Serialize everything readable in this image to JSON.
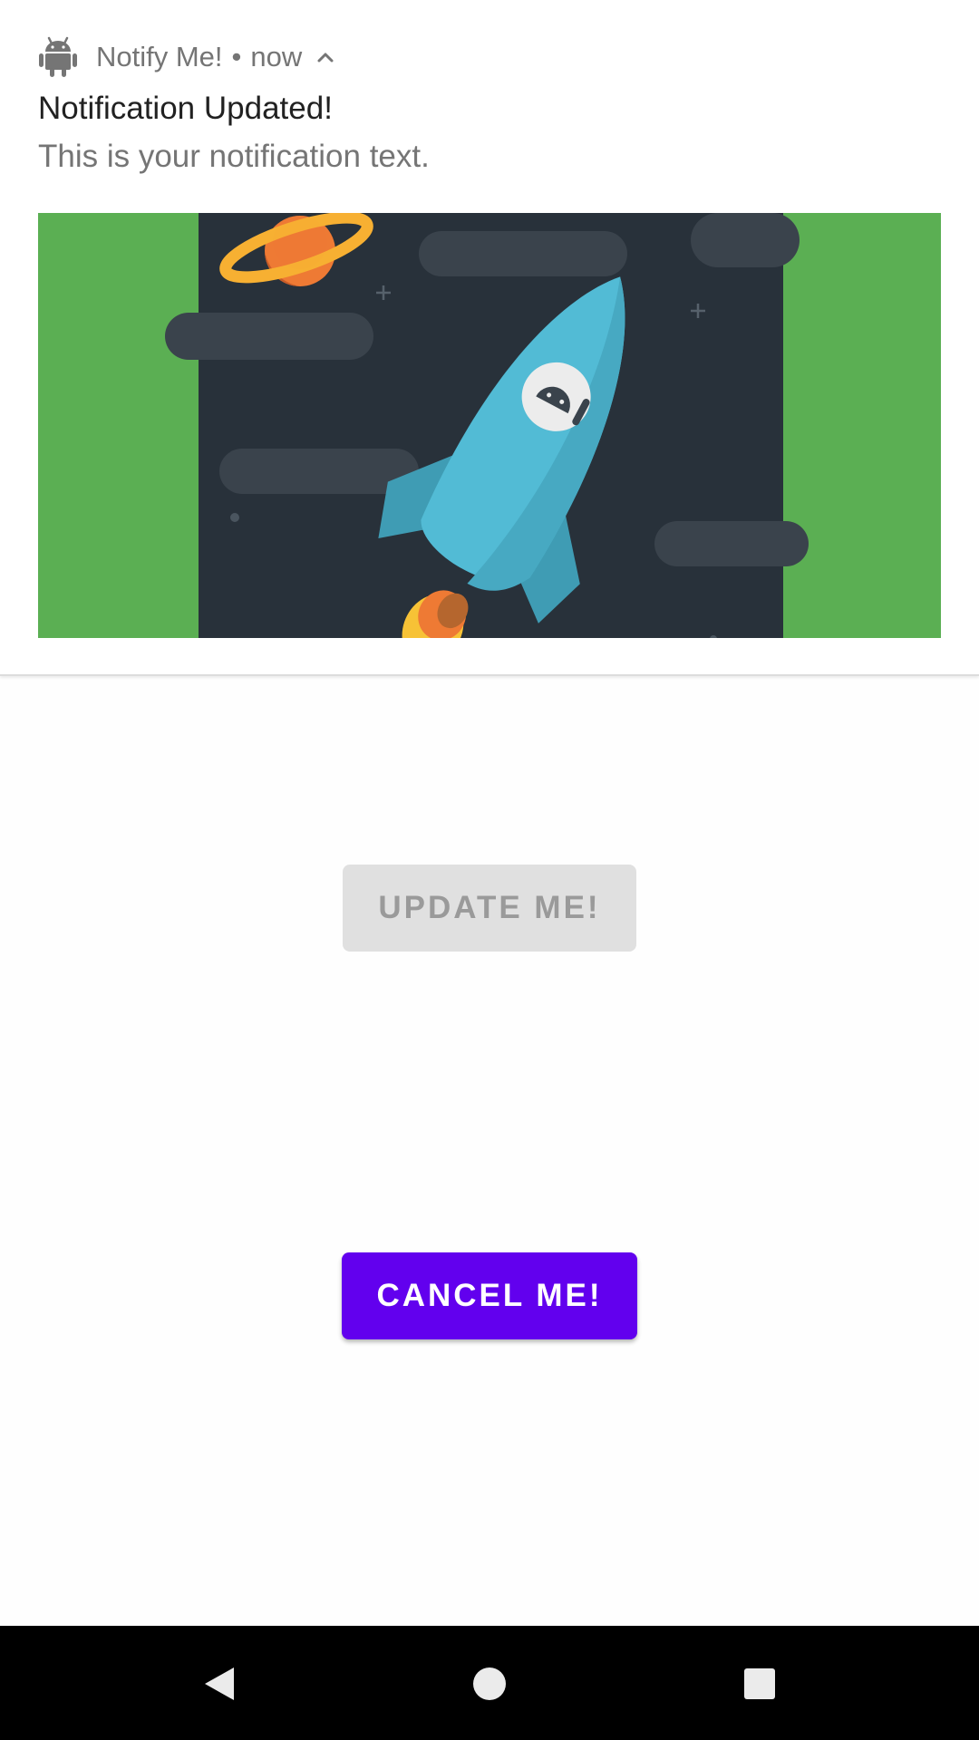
{
  "notification": {
    "app_name": "Notify Me!",
    "separator": "•",
    "time": "now",
    "title": "Notification Updated!",
    "text": "This is your notification text.",
    "app_icon": "android-icon",
    "expand_icon": "chevron-up-icon",
    "image": "rocket-illustration"
  },
  "buttons": {
    "update_label": "UPDATE ME!",
    "cancel_label": "CANCEL ME!"
  },
  "colors": {
    "accent": "#6200ee",
    "image_bg": "#5baf53",
    "space_bg": "#28313a",
    "rocket": "#52bbd5"
  },
  "navbar": {
    "back_icon": "back-icon",
    "home_icon": "home-icon",
    "recents_icon": "recents-icon"
  }
}
